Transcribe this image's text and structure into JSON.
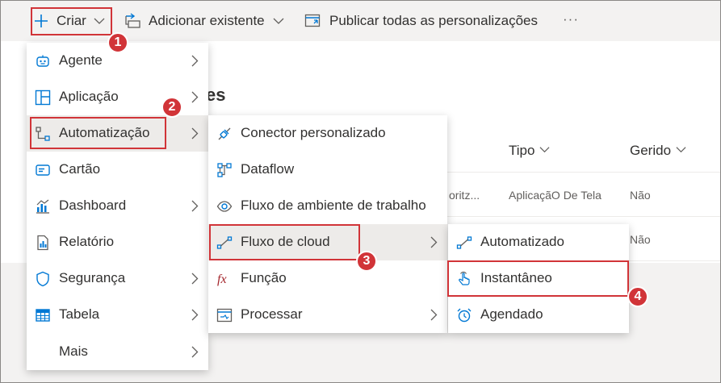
{
  "toolbar": {
    "create_label": "Criar",
    "add_existing_label": "Adicionar existente",
    "publish_label": "Publicar todas as personalizações",
    "more_label": "···"
  },
  "page": {
    "title_fragment": "es",
    "columns": {
      "tipo": "Tipo",
      "gerido": "Gerido"
    },
    "rows": [
      {
        "name_fragment": "oritz...",
        "tipo": "AplicaçãO De Tela",
        "gerido": "Não"
      },
      {
        "gerido": "Não"
      }
    ]
  },
  "menu1": {
    "items": [
      {
        "label": "Agente",
        "icon": "agent-icon"
      },
      {
        "label": "Aplicação",
        "icon": "app-icon"
      },
      {
        "label": "Automatização",
        "icon": "automation-icon"
      },
      {
        "label": "Cartão",
        "icon": "card-icon"
      },
      {
        "label": "Dashboard",
        "icon": "dashboard-icon"
      },
      {
        "label": "Relatório",
        "icon": "report-icon"
      },
      {
        "label": "Segurança",
        "icon": "shield-icon"
      },
      {
        "label": "Tabela",
        "icon": "table-icon"
      },
      {
        "label": "Mais"
      }
    ]
  },
  "menu2": {
    "items": [
      {
        "label": "Conector personalizado",
        "icon": "connector-icon"
      },
      {
        "label": "Dataflow",
        "icon": "dataflow-icon"
      },
      {
        "label": "Fluxo de ambiente de trabalho",
        "icon": "eye-icon"
      },
      {
        "label": "Fluxo de cloud",
        "icon": "cloud-flow-icon"
      },
      {
        "label": "Função",
        "icon": "fx-icon"
      },
      {
        "label": "Processar",
        "icon": "process-icon"
      }
    ]
  },
  "menu3": {
    "items": [
      {
        "label": "Automatizado",
        "icon": "automated-flow-icon"
      },
      {
        "label": "Instantâneo",
        "icon": "touch-icon"
      },
      {
        "label": "Agendado",
        "icon": "alarm-clock-icon"
      }
    ]
  },
  "steps": [
    "1",
    "2",
    "3",
    "4"
  ],
  "colors": {
    "accent": "#0078d4",
    "callout": "#d13438",
    "highlight": "#edebe9"
  }
}
